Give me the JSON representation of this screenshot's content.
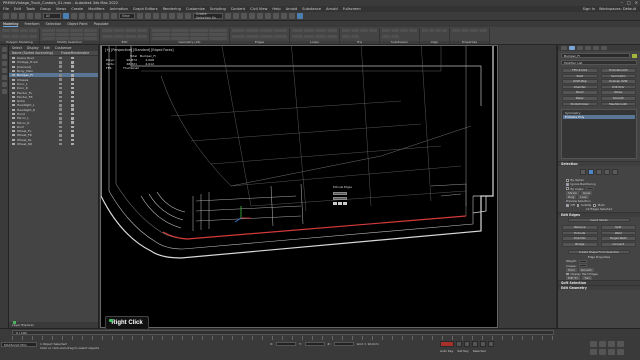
{
  "window": {
    "title": "PRM00Vintage_Truck_Custom_01.max - Autodesk 3ds Max 2022"
  },
  "menu": {
    "items": [
      "File",
      "Edit",
      "Tools",
      "Group",
      "Views",
      "Create",
      "Modifiers",
      "Animation",
      "Graph Editors",
      "Rendering",
      "Customize",
      "Scripting",
      "Content",
      "Civil View",
      "Help",
      "Arnold",
      "Substance",
      "Arnold",
      "Fullscreen"
    ],
    "workspace": "Workspaces: Default",
    "sign_in": "Sign In"
  },
  "toolbar": {
    "selection_set": "Create Selection Se",
    "view_dropdown": "View"
  },
  "ribbon": {
    "tabs": [
      "Modeling",
      "Freeform",
      "Selection",
      "Object Paint",
      "Populate"
    ],
    "active_tab": "Modeling",
    "groups": [
      "Polygon Modeling",
      "Modify Selection",
      "Edit",
      "Geometry (All)",
      "Edges",
      "Loops",
      "Tris",
      "Subdivision",
      "Align",
      "Properties"
    ]
  },
  "scene_explorer": {
    "tabs": [
      "Select",
      "Display",
      "Edit",
      "Customize"
    ],
    "col_name": "Name (Sorted Ascending)",
    "col_frozen": "Frozen",
    "col_renderable": "Renderable",
    "rows": [
      {
        "name": "Scene Root",
        "selected": false
      },
      {
        "name": "Vintage_Truck",
        "selected": false
      },
      {
        "name": "[Camera]",
        "selected": false
      },
      {
        "name": "Body_Main",
        "selected": false
      },
      {
        "name": "Bumper_Fr",
        "selected": true
      },
      {
        "name": "Chassis",
        "selected": false
      },
      {
        "name": "Door_L",
        "selected": false
      },
      {
        "name": "Door_R",
        "selected": false
      },
      {
        "name": "Fender_FL",
        "selected": false
      },
      {
        "name": "Fender_FR",
        "selected": false
      },
      {
        "name": "Grille",
        "selected": false
      },
      {
        "name": "Headlight_L",
        "selected": false
      },
      {
        "name": "Headlight_R",
        "selected": false
      },
      {
        "name": "Hood",
        "selected": false
      },
      {
        "name": "Mirror_L",
        "selected": false
      },
      {
        "name": "Mirror_R",
        "selected": false
      },
      {
        "name": "Roof",
        "selected": false
      },
      {
        "name": "Wheel_FL",
        "selected": false
      },
      {
        "name": "Wheel_FR",
        "selected": false
      },
      {
        "name": "Wheel_RL",
        "selected": false
      },
      {
        "name": "Wheel_RR",
        "selected": false
      }
    ],
    "footer_label": "Layer Explorer"
  },
  "viewport": {
    "label": "[+] [Perspective] [Standard] [Edged Faces]",
    "stats": {
      "header_total": "Total",
      "header_obj": "Bumper_Fr",
      "polys_label": "Polys:",
      "polys_total": "96,872",
      "polys_obj": "4,008",
      "verts_label": "Verts:",
      "verts_total": "48,321",
      "verts_obj": "2,012",
      "fps_label": "FPS:",
      "fps_value": "Thumbnail"
    },
    "caddy_title": "Extrude Edges"
  },
  "command_panel": {
    "object_name": "Bumper_Fr",
    "modifier_list": "Modifier List",
    "buttons": [
      "FFD 2x2x2",
      "TurboSmooth",
      "Shell",
      "Symmetry",
      "UVW Map",
      "Unwrap UVW",
      "Chamfer",
      "Edit Poly",
      "Bend",
      "Noise",
      "Relax",
      "Smooth",
      "ProOptimizer",
      "MeshSmooth"
    ],
    "stack": [
      "Symmetry",
      "Editable Poly"
    ],
    "selection_rollout": "Selection",
    "by_vertex": "By Vertex",
    "ignore_backfacing": "Ignore Backfacing",
    "by_angle": "By Angle:",
    "shrink": "Shrink",
    "grow": "Grow",
    "ring": "Ring",
    "loop": "Loop",
    "preview_selection": "Preview Selection",
    "preview_off": "Off",
    "preview_subobj": "SubObj",
    "preview_multi": "Multi",
    "edges_selected": "12 Edges Selected",
    "edit_edges_rollout": "Edit Edges",
    "insert_vertex": "Insert Vertex",
    "remove": "Remove",
    "split": "Split",
    "extrude": "Extrude",
    "weld": "Weld",
    "chamfer": "Chamfer",
    "target_weld": "Target Weld",
    "bridge": "Bridge",
    "connect": "Connect",
    "create_shape": "Create Shape From Selection",
    "edge_properties": "Edge Properties",
    "weight": "Weight:",
    "crease": "Crease:",
    "hard": "Hard",
    "smooth": "Smooth",
    "display_hard": "Display Hard Edges",
    "edit_tri": "Edit Tri.",
    "turn": "Turn",
    "soft_selection": "Soft Selection",
    "edit_geometry": "Edit Geometry"
  },
  "status": {
    "maxscript": "MAXScript Mini",
    "selection_info": "1 Object Selected",
    "prompt": "Click or click-and-drag to select objects",
    "x_label": "X:",
    "y_label": "Y:",
    "z_label": "Z:",
    "grid": "Grid = 10,0cm",
    "timeline": "0 / 100",
    "autokey": "Auto Key",
    "set_key": "Set Key",
    "selected": "Selected"
  },
  "overlay": {
    "right_click": "Right Click"
  }
}
